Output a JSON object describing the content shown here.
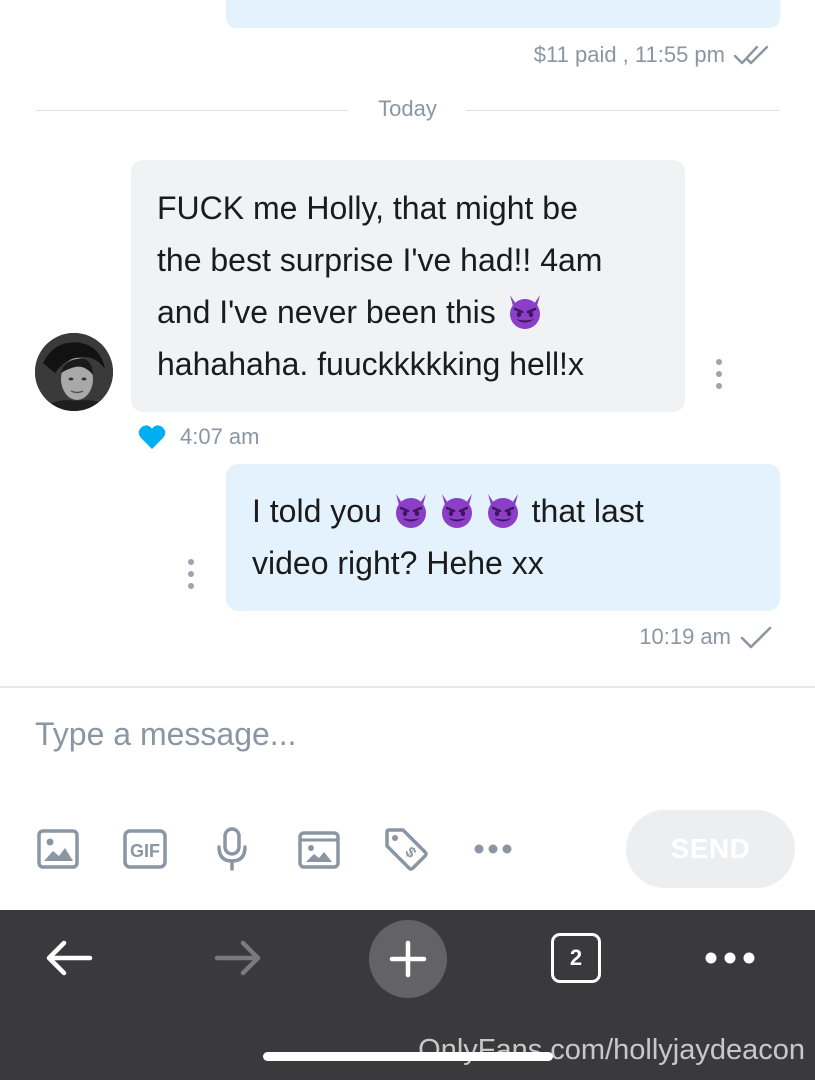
{
  "previous_message": {
    "meta": "$11 paid , 11:55 pm",
    "status": "read-double-check-icon"
  },
  "divider": {
    "label": "Today"
  },
  "incoming": {
    "lines": [
      "FUCK me Holly, that might be",
      "the best surprise I've had!! 4am",
      "and I've never been this ",
      "hahahaha. fuuckkkkking hell!x"
    ],
    "emoji": "smiling-devil-emoji",
    "liked": true,
    "time": "4:07 am"
  },
  "outgoing": {
    "line1_before": "I told you ",
    "line1_after": " that last",
    "line2": "video right? Hehe xx",
    "emoji_count": 3,
    "time": "10:19 am",
    "status": "sent-check-icon"
  },
  "composer": {
    "placeholder": "Type a message...",
    "send_label": "SEND",
    "tools": [
      "image-icon",
      "gif-icon",
      "microphone-icon",
      "vault-icon",
      "price-tag-icon",
      "more-icon"
    ]
  },
  "browser": {
    "tab_count": "2",
    "watermark": "OnlyFans.com/hollyjaydeacon"
  },
  "colors": {
    "outgoing_bubble": "#e3f2fc",
    "incoming_bubble": "#f1f2f4",
    "accent": "#00aff0",
    "browser_bar": "#3a3a3c",
    "emoji_purple": "#8b3fc7"
  }
}
